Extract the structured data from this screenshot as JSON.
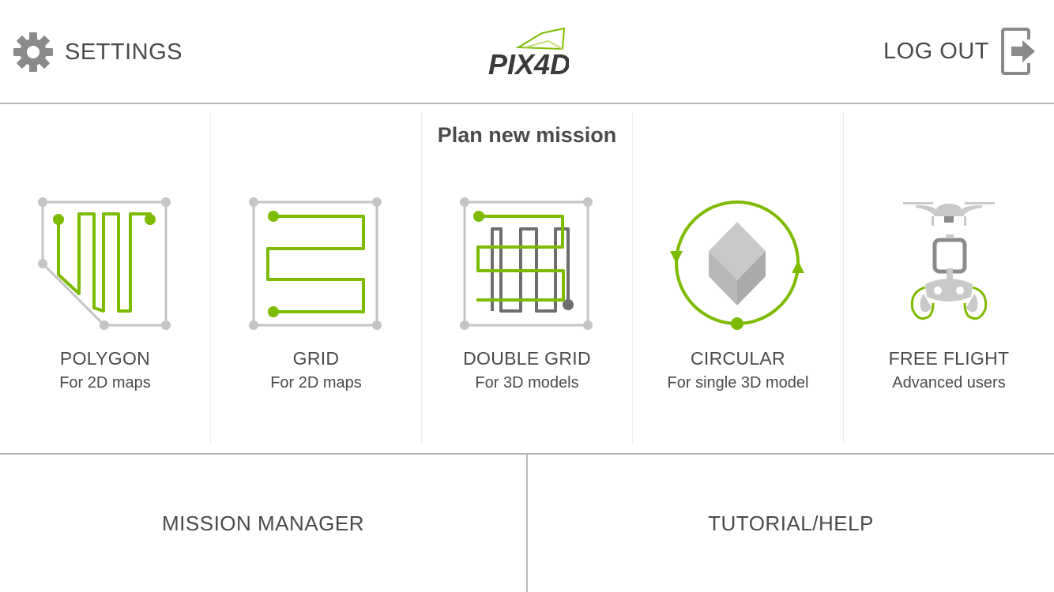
{
  "header": {
    "settings_label": "SETTINGS",
    "settings_icon": "gear-icon",
    "logo_icon": "pix4d-logo",
    "logo_text": "PIX4D",
    "logout_label": "LOG OUT",
    "logout_icon": "logout-icon"
  },
  "plan": {
    "title": "Plan new mission",
    "missions": [
      {
        "name": "POLYGON",
        "subtitle": "For 2D maps",
        "icon": "polygon-path-icon"
      },
      {
        "name": "GRID",
        "subtitle": "For 2D maps",
        "icon": "grid-path-icon"
      },
      {
        "name": "DOUBLE GRID",
        "subtitle": "For 3D models",
        "icon": "double-grid-path-icon"
      },
      {
        "name": "CIRCULAR",
        "subtitle": "For single 3D model",
        "icon": "circular-path-icon"
      },
      {
        "name": "FREE FLIGHT",
        "subtitle": "Advanced users",
        "icon": "drone-controller-icon"
      }
    ]
  },
  "bottom": {
    "mission_manager_label": "MISSION MANAGER",
    "tutorial_label": "TUTORIAL/HELP"
  },
  "colors": {
    "accent_green": "#7dbb00",
    "gray_line": "#c4c4c4",
    "dark_gray": "#6e6e6e",
    "text": "#4a4a4a",
    "divider": "#b9b9b9"
  }
}
